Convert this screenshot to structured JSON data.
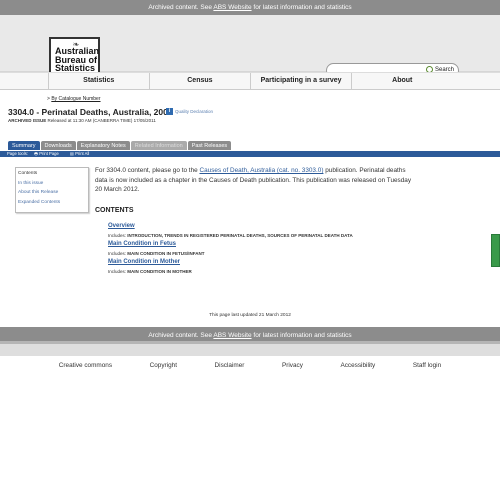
{
  "archive_bar": {
    "prefix": "Archived content. See ",
    "link": "ABS Website",
    "suffix": " for latest information and statistics"
  },
  "logo": {
    "line1": "Australian",
    "line2": "Bureau of",
    "line3": "Statistics"
  },
  "search": {
    "button": "Search",
    "placeholder": ""
  },
  "nav": [
    "Statistics",
    "Census",
    "Participating in a survey",
    "About"
  ],
  "breadcrumb": {
    "prefix": "> ",
    "link": "By Catalogue Number"
  },
  "page": {
    "title": "3304.0 - Perinatal Deaths, Australia, 2009",
    "quality": "Quality Declaration",
    "archived_label": "ARCHIVED ISSUE",
    "archived_text": "Released at 11:30 AM (CANBERRA TIME) 17/05/2011"
  },
  "tabs": [
    "Summary",
    "Downloads",
    "Explanatory Notes",
    "Related Information",
    "Past Releases"
  ],
  "page_tools": {
    "label": "Page tools:",
    "print_page": "Print Page",
    "print_all": "Print All"
  },
  "sidebar": {
    "head": "Contents",
    "items": [
      "In this issue",
      "About this Release",
      "Expanded Contents"
    ]
  },
  "main": {
    "p1": "For 3304.0 content, please go to the ",
    "p1_link": "Causes of Death, Australia (cat. no. 3303.0)",
    "p1_rest": " publication. Perinatal deaths data is now included as a chapter in the Causes of Death publication. This publication was released on Tuesday 20 March 2012.",
    "contents_heading": "CONTENTS",
    "sections": [
      {
        "title": "Overview",
        "includes_label": "Includes: ",
        "includes": "INTRODUCTION, TRENDS IN REGISTERED PERINATAL DEATHS, SOURCES OF PERINATAL DEATH DATA"
      },
      {
        "title": "Main Condition in Fetus",
        "includes_label": "Includes: ",
        "includes": "MAIN CONDITION IN FETUS/INFANT"
      },
      {
        "title": "Main Condition in Mother",
        "includes_label": "Includes: ",
        "includes": "MAIN CONDITION IN MOTHER"
      }
    ]
  },
  "updated": "This page last updated 21 March 2012",
  "footer_links": [
    "Creative commons",
    "Copyright",
    "Disclaimer",
    "Privacy",
    "Accessibility",
    "Staff login"
  ]
}
